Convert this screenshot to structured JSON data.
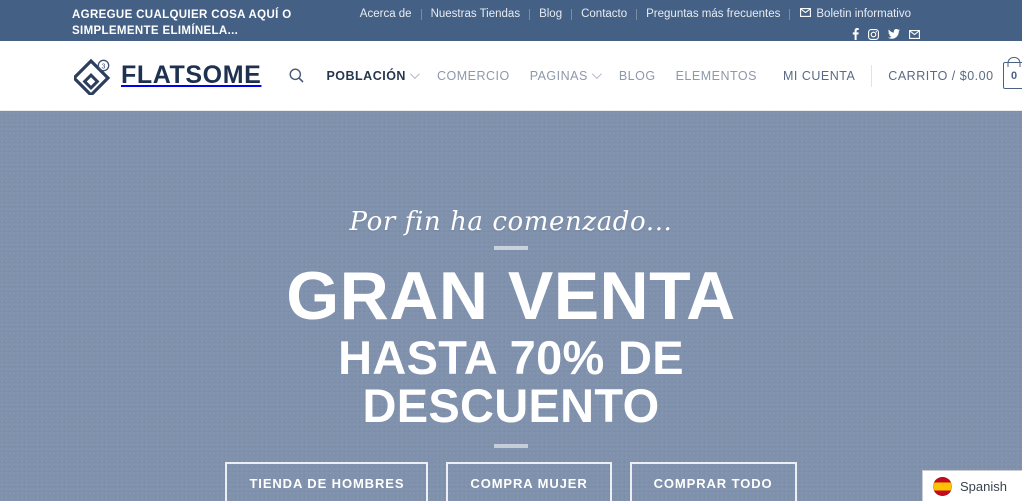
{
  "topbar": {
    "promo_text": "AGREGUE CUALQUIER COSA AQUÍ O SIMPLEMENTE ELIMÍNELA...",
    "links": [
      {
        "label": "Acerca de",
        "name": "topbar-link-acerca-de"
      },
      {
        "label": "Nuestras Tiendas",
        "name": "topbar-link-nuestras-tiendas"
      },
      {
        "label": "Blog",
        "name": "topbar-link-blog"
      },
      {
        "label": "Contacto",
        "name": "topbar-link-contacto"
      },
      {
        "label": "Preguntas más frecuentes",
        "name": "topbar-link-preguntas-mas-frecuentes"
      }
    ],
    "newsletter_label": "Boletin informativo",
    "newsletter_icon": "envelope-icon",
    "social": [
      {
        "icon": "facebook-icon",
        "glyph": "f"
      },
      {
        "icon": "instagram-icon",
        "glyph": "◉"
      },
      {
        "icon": "twitter-icon",
        "glyph": "🐦"
      },
      {
        "icon": "email-icon",
        "glyph": "✉"
      }
    ],
    "background_color": "#446084"
  },
  "header": {
    "logo_text": "FLATSOME",
    "logo_badge": "3",
    "search_icon": "search-icon",
    "nav": [
      {
        "label": "POBLACIÓN",
        "has_dropdown": true,
        "active": true
      },
      {
        "label": "COMERCIO",
        "has_dropdown": false,
        "active": false
      },
      {
        "label": "PAGINAS",
        "has_dropdown": true,
        "active": false
      },
      {
        "label": "BLOG",
        "has_dropdown": false,
        "active": false
      },
      {
        "label": "ELEMENTOS",
        "has_dropdown": false,
        "active": false
      }
    ],
    "account_label": "MI CUENTA",
    "cart_label": "CARRITO / $0.00",
    "cart_count": "0",
    "cart_icon": "shopping-bag-icon"
  },
  "hero": {
    "script_text": "Por fin ha comenzado...",
    "headline": "GRAN VENTA",
    "subheadline_line1": "HASTA 70% DE",
    "subheadline_line2": "DESCUENTO",
    "buttons": [
      {
        "label": "TIENDA DE HOMBRES",
        "name": "cta-tienda-de-hombres"
      },
      {
        "label": "COMPRA MUJER",
        "name": "cta-compra-mujer"
      },
      {
        "label": "COMPRAR TODO",
        "name": "cta-comprar-todo"
      }
    ],
    "background_color": "#7f91ac"
  },
  "language_widget": {
    "label": "Spanish",
    "flag_icon": "spain-flag-icon"
  }
}
